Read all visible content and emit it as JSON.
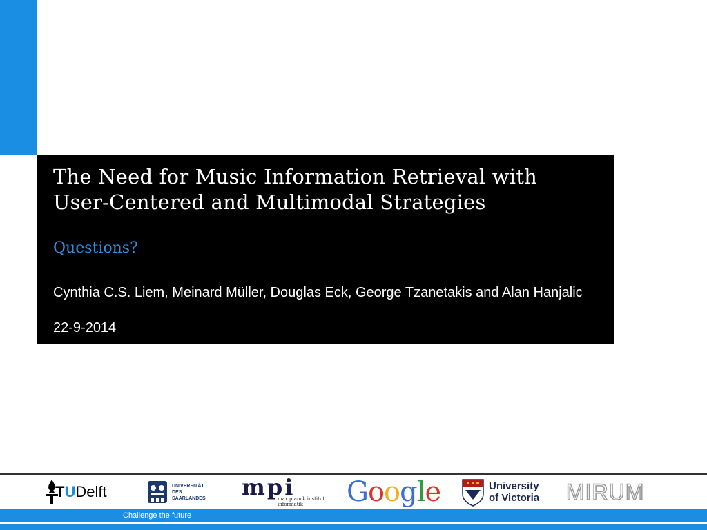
{
  "slide": {
    "title_line1": "The Need for Music Information Retrieval with",
    "title_line2": "User-Centered and Multimodal Strategies",
    "subtitle": "Questions?",
    "authors": "Cynthia C.S. Liem, Meinard Müller, Douglas Eck, George Tzanetakis and Alan Hanjalic",
    "date": "22-9-2014"
  },
  "logos": {
    "tudelft": {
      "t": "T",
      "u": "U",
      "rest": "Delft"
    },
    "saarland": {
      "line1": "UNIVERSITÄT",
      "line2": "DES",
      "line3": "SAARLANDES"
    },
    "mpi": {
      "mark": "mpi",
      "line1": "max planck institut",
      "line2": "informatik"
    },
    "google": {
      "letters": [
        "G",
        "o",
        "o",
        "g",
        "l",
        "e"
      ],
      "colors": [
        "#3b6fd6",
        "#d8362b",
        "#f2b01e",
        "#3b6fd6",
        "#2e9b3f",
        "#d8362b"
      ]
    },
    "uvic": {
      "line1": "University",
      "line2": "of Victoria"
    },
    "mirum": {
      "text": "MIRUM"
    }
  },
  "footer": {
    "tagline": "Challenge the future"
  },
  "colors": {
    "accent": "#1a8ee2",
    "subtitle": "#2a8fe0",
    "box": "#000000"
  }
}
